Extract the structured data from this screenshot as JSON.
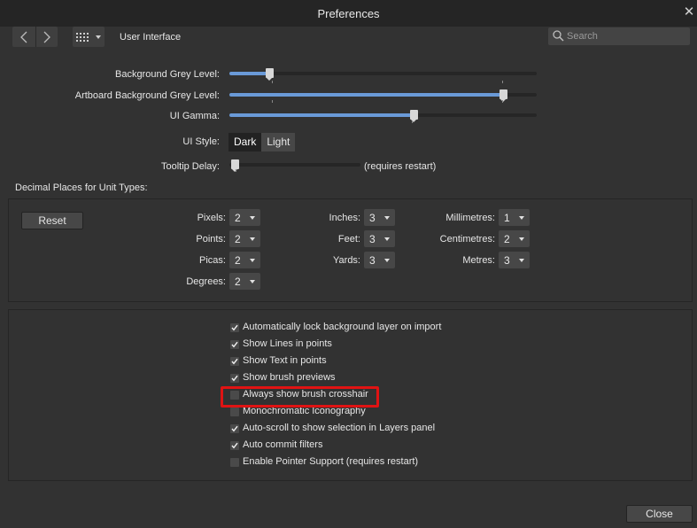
{
  "window": {
    "title": "Preferences"
  },
  "toolbar": {
    "section": "User Interface",
    "search_placeholder": "Search"
  },
  "sliders": [
    {
      "label": "Background Grey Level:",
      "value": 0.13
    },
    {
      "label": "Artboard Background Grey Level:",
      "value": 0.89
    },
    {
      "label": "UI Gamma:",
      "value": 0.6
    }
  ],
  "ui_style": {
    "label": "UI Style:",
    "options": [
      "Dark",
      "Light"
    ],
    "selected": "Dark"
  },
  "tooltip": {
    "label": "Tooltip Delay:",
    "value": 0.04,
    "note": "(requires restart)"
  },
  "units": {
    "heading": "Decimal Places for Unit Types:",
    "reset_label": "Reset",
    "col1": [
      {
        "label": "Pixels:",
        "value": "2"
      },
      {
        "label": "Points:",
        "value": "2"
      },
      {
        "label": "Picas:",
        "value": "2"
      },
      {
        "label": "Degrees:",
        "value": "2"
      }
    ],
    "col2": [
      {
        "label": "Inches:",
        "value": "3"
      },
      {
        "label": "Feet:",
        "value": "3"
      },
      {
        "label": "Yards:",
        "value": "3"
      }
    ],
    "col3": [
      {
        "label": "Millimetres:",
        "value": "1"
      },
      {
        "label": "Centimetres:",
        "value": "2"
      },
      {
        "label": "Metres:",
        "value": "3"
      }
    ]
  },
  "options": [
    {
      "label": "Automatically lock background layer on import",
      "checked": true
    },
    {
      "label": "Show Lines in points",
      "checked": true
    },
    {
      "label": "Show Text in points",
      "checked": true
    },
    {
      "label": "Show brush previews",
      "checked": true
    },
    {
      "label": "Always show brush crosshair",
      "checked": false
    },
    {
      "label": "Monochromatic Iconography",
      "checked": false
    },
    {
      "label": "Auto-scroll to show selection in Layers panel",
      "checked": true
    },
    {
      "label": "Auto commit filters",
      "checked": true
    },
    {
      "label": "Enable Pointer Support (requires restart)",
      "checked": false
    }
  ],
  "highlight_color": "#e01313",
  "accent_color": "#6a9ad8",
  "footer": {
    "close_label": "Close"
  }
}
